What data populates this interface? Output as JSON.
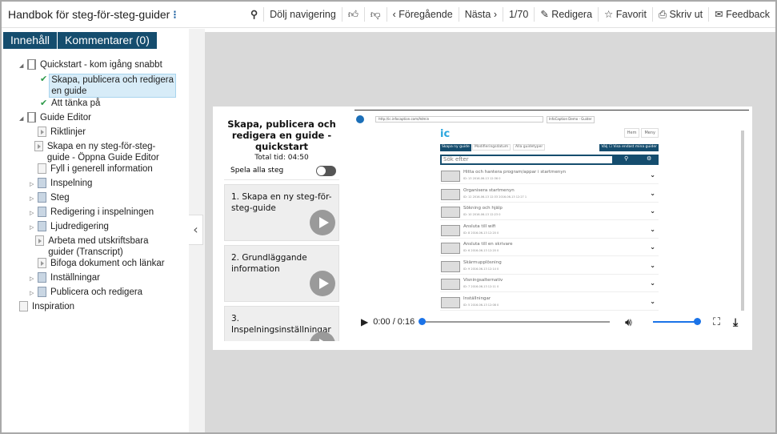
{
  "header": {
    "title": "Handbok för steg-för-steg-guider",
    "menu_icon": "vertical-dots-icon",
    "toolbar": {
      "search_icon": "search-icon",
      "hide_nav": "Dölj navigering",
      "like_icon": "thumbs-up-icon",
      "dislike_icon": "thumbs-down-icon",
      "previous": "‹ Föregående",
      "next": "Nästa ›",
      "page": "1/70",
      "edit": "Redigera",
      "favorite": "Favorit",
      "print": "Skriv ut",
      "feedback": "Feedback"
    }
  },
  "sidebar": {
    "tabs": [
      "Innehåll",
      "Kommentarer (0)"
    ],
    "tree": [
      {
        "label": "Quickstart - kom igång snabbt",
        "icon": "open-book-icon",
        "expanded": true,
        "level": 0
      },
      {
        "label": "Skapa, publicera och redigera en guide",
        "icon": "check-icon",
        "selected": true,
        "level": 1
      },
      {
        "label": "Att tänka på",
        "icon": "check-icon",
        "level": 1
      },
      {
        "label": "Guide Editor",
        "icon": "open-book-icon",
        "expanded": true,
        "level": 0
      },
      {
        "label": "Riktlinjer",
        "icon": "video-page-icon",
        "level": 1
      },
      {
        "label": "Skapa en ny steg-för-steg-guide - Öppna Guide Editor",
        "icon": "video-page-icon",
        "level": 1
      },
      {
        "label": "Fyll i generell information",
        "icon": "page-icon",
        "level": 1
      },
      {
        "label": "Inspelning",
        "icon": "book-icon",
        "collapsed": true,
        "level": 1
      },
      {
        "label": "Steg",
        "icon": "book-icon",
        "collapsed": true,
        "level": 1
      },
      {
        "label": "Redigering i inspelningen",
        "icon": "book-icon",
        "collapsed": true,
        "level": 1
      },
      {
        "label": "Ljudredigering",
        "icon": "book-icon",
        "collapsed": true,
        "level": 1
      },
      {
        "label": "Arbeta med utskriftsbara guider (Transcript)",
        "icon": "video-page-icon",
        "level": 1
      },
      {
        "label": "Bifoga dokument och länkar",
        "icon": "video-page-icon",
        "level": 1
      },
      {
        "label": "Inställningar",
        "icon": "book-icon",
        "collapsed": true,
        "level": 1
      },
      {
        "label": "Publicera och redigera",
        "icon": "book-icon",
        "collapsed": true,
        "level": 1
      },
      {
        "label": "Inspiration",
        "icon": "page-icon",
        "level": 0
      }
    ]
  },
  "guide": {
    "title": "Skapa, publicera och redigera en guide - quickstart",
    "total_time": "Total tid: 04:50",
    "play_all": "Spela alla steg",
    "play_all_on": false,
    "steps": [
      "1. Skapa en ny steg-för-steg-guide",
      "2. Grundläggande information",
      "3. Inspelningsinställningar"
    ]
  },
  "video": {
    "browser": {
      "url": "http://ic.infocaption.com/Admin",
      "tab": "InfoCaption Demo - Guider"
    },
    "app": {
      "logo": "ic",
      "home": "Hem",
      "menu": "Meny",
      "create": "Skapa ny guide",
      "sort": "Modifieringsdatum",
      "types": "Alla guidetyper",
      "choose": "Välj",
      "only_mine": "Visa endast mina guider",
      "search_placeholder": "Sök efter",
      "rows": [
        {
          "title": "Hitta och hantera program/appar i startmenyn",
          "meta": "ID: 13   2016-06-13 12:36   0"
        },
        {
          "title": "Organisera startmenyn",
          "meta": "ID: 12   2016-06-13 12:33   2016-06-13 12:27   1"
        },
        {
          "title": "Sökning och hjälp",
          "meta": "ID: 10   2016-06-13 12:23   0"
        },
        {
          "title": "Ansluta till wifi",
          "meta": "ID: 8   2016-06-13 12:20   0"
        },
        {
          "title": "Ansluta till en skrivare",
          "meta": "ID: 6   2016-06-13 12:20   0"
        },
        {
          "title": "Skärmupplösning",
          "meta": "ID: 9   2016-06-13 12:14   0"
        },
        {
          "title": "Visningsalternativ",
          "meta": "ID: 7   2016-06-13 12:11   0"
        },
        {
          "title": "Inställningar",
          "meta": "ID: 5   2016-06-13 12:08   0"
        }
      ]
    },
    "time": "0:00 / 0:16",
    "progress": 0,
    "volume": 1.0,
    "accent": "#1b73e8"
  },
  "colors": {
    "tab_bg": "#154d6e",
    "selected_bg": "#d7ecf8",
    "check": "#2e9a4a"
  }
}
